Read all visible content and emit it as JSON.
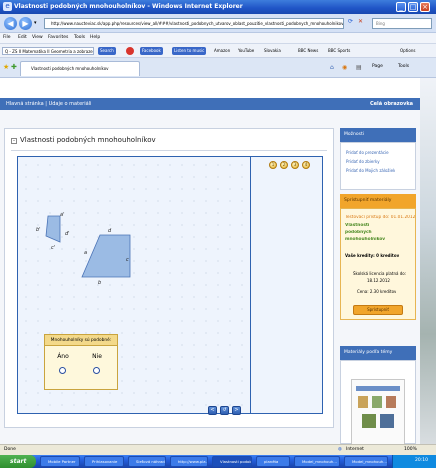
{
  "window": {
    "title": "Vlastnosti podobných mnohouholníkov - Windows Internet Explorer",
    "buttons": {
      "minimize": "_",
      "maximize": "□",
      "close": "×"
    }
  },
  "addressbar": {
    "url": "http://www.naucteviac.sk/app.php/resources/view_all/###/vlastnosti_podobnych_utvarov_oblast_pouzitie_vlastnosti_podobnych_mnohouholnikov_zakladne_delenie",
    "search_placeholder": "Bing"
  },
  "menubar": [
    "File",
    "Edit",
    "View",
    "Favorites",
    "Tools",
    "Help"
  ],
  "linkbar": {
    "search_field": "Q - ZS II  Matematika  II  Geometria a zobrazenia",
    "search_btn": "Search",
    "items": [
      "Facebook",
      "Listen to music",
      "Amazon",
      "YouTube",
      "Slovakia",
      "BBC News",
      "BBC Sports"
    ],
    "options": "Options"
  },
  "tab": {
    "label": "Vlastnosti podobných mnohouholníkov"
  },
  "page_tools": [
    "Page",
    "Tools"
  ],
  "site": {
    "breadcrumb": "Hlavná stránka  |  Údaje o materiáli",
    "fullscreen": "Celá obrazovka"
  },
  "card": {
    "title": "Vlastnosti podobných mnohouholníkov",
    "top_controls": [
      "1",
      "2",
      "3",
      "4"
    ],
    "bottom_controls": [
      "<",
      "↺",
      ">"
    ]
  },
  "figure": {
    "small_labels": {
      "a": "a'",
      "b": "b'",
      "c": "c'",
      "d": "d'"
    },
    "large_labels": {
      "a": "a",
      "b": "b",
      "c": "c",
      "d": "d"
    }
  },
  "question": {
    "prompt": "Mnohouholníky sú podobné:",
    "options": [
      "Áno",
      "Nie"
    ]
  },
  "sidebar": {
    "section1": {
      "title": "Možnosti",
      "items": [
        "Pridať do prezentácie",
        "Pridať do zbierky",
        "Pridať do Mojich záložiek"
      ]
    },
    "section2": {
      "title": "Sprístupniť materiály",
      "trial": "Testovací prístup do: 01.01.2012",
      "material_1": "Vlastnosti",
      "material_2": "podobných",
      "material_3": "mnohouholníkov",
      "credit": "Vaše kredity: 0 kreditov",
      "school_1": "Školská licencia platná do:",
      "school_2": "18.12.2012",
      "price": "Cena: 2.30 kreditov",
      "button": "Sprístupniť"
    },
    "section3": {
      "title": "Materiály podľa témy"
    }
  },
  "statusbar": {
    "left": "Done",
    "zone": "Internet",
    "zoom": "100%"
  },
  "taskbar": {
    "start": "start",
    "tasks": [
      "Mobile Partner",
      "Prihlasovanie",
      "Sieťová náhrada",
      "http://www.pla...",
      "Vlastnosti podob...",
      "planéta",
      "Model_mnohouh...",
      "Model_mnohouh..."
    ],
    "clock": "20:10"
  },
  "colors": {
    "title_blue": "#1f54c6",
    "site_header": "#3f6fb8",
    "applet_border": "#2e62b0",
    "accent_orange": "#f1a52b",
    "link_blue": "#3a67b4"
  }
}
